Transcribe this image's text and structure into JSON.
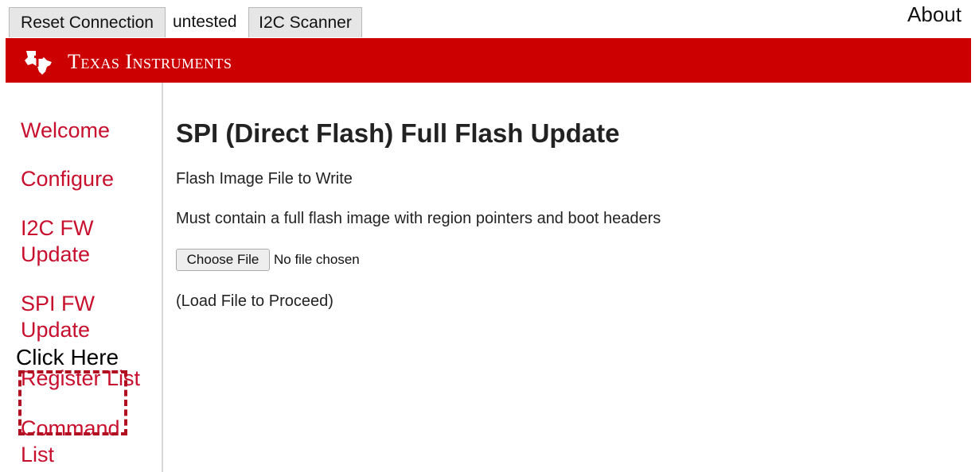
{
  "topbar": {
    "reset_label": "Reset Connection",
    "status": "untested",
    "scanner_label": "I2C Scanner",
    "about_label": "About"
  },
  "banner": {
    "brand": "Texas Instruments",
    "color": "#cc0000",
    "logo_icon": "texas-state-icon"
  },
  "sidebar": {
    "items": [
      {
        "label": "Welcome"
      },
      {
        "label": "Configure"
      },
      {
        "label": "I2C FW Update"
      },
      {
        "label": "SPI FW Update"
      },
      {
        "label": "Register List"
      },
      {
        "label": "Command List"
      }
    ],
    "link_color": "#c8102e"
  },
  "callout": {
    "label": "Click Here",
    "border_color": "#b01020"
  },
  "main": {
    "title": "SPI (Direct Flash) Full Flash Update",
    "subtitle": "Flash Image File to Write",
    "description": "Must contain a full flash image with region pointers and boot headers",
    "choose_file_label": "Choose File",
    "file_status": "No file chosen",
    "load_note": "(Load File to Proceed)"
  }
}
